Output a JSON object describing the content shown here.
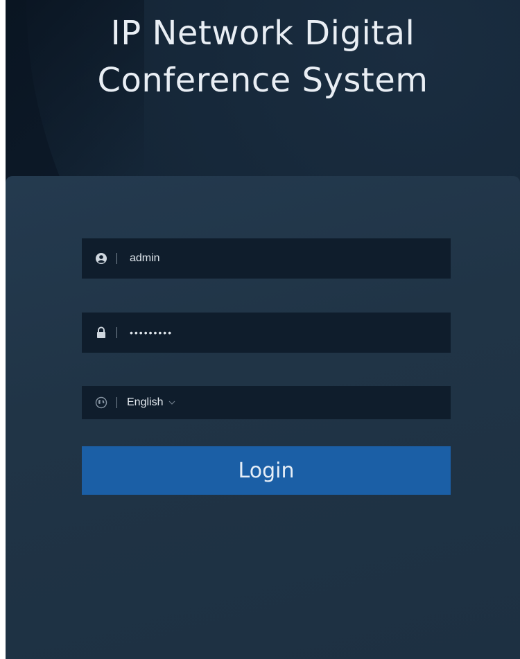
{
  "app": {
    "title_line1": "IP Network Digital",
    "title_line2": "Conference System"
  },
  "login_form": {
    "username": {
      "icon": "user-icon",
      "value": "admin"
    },
    "password": {
      "icon": "lock-icon",
      "masked_value": "•••••••••"
    },
    "language": {
      "icon": "globe-icon",
      "selected": "English"
    },
    "login_label": "Login"
  },
  "colors": {
    "background": "#0d1a29",
    "card": "#213649",
    "field": "#0f1d2c",
    "accent_button": "#1b5fa6",
    "title_text": "#e9eef4"
  }
}
